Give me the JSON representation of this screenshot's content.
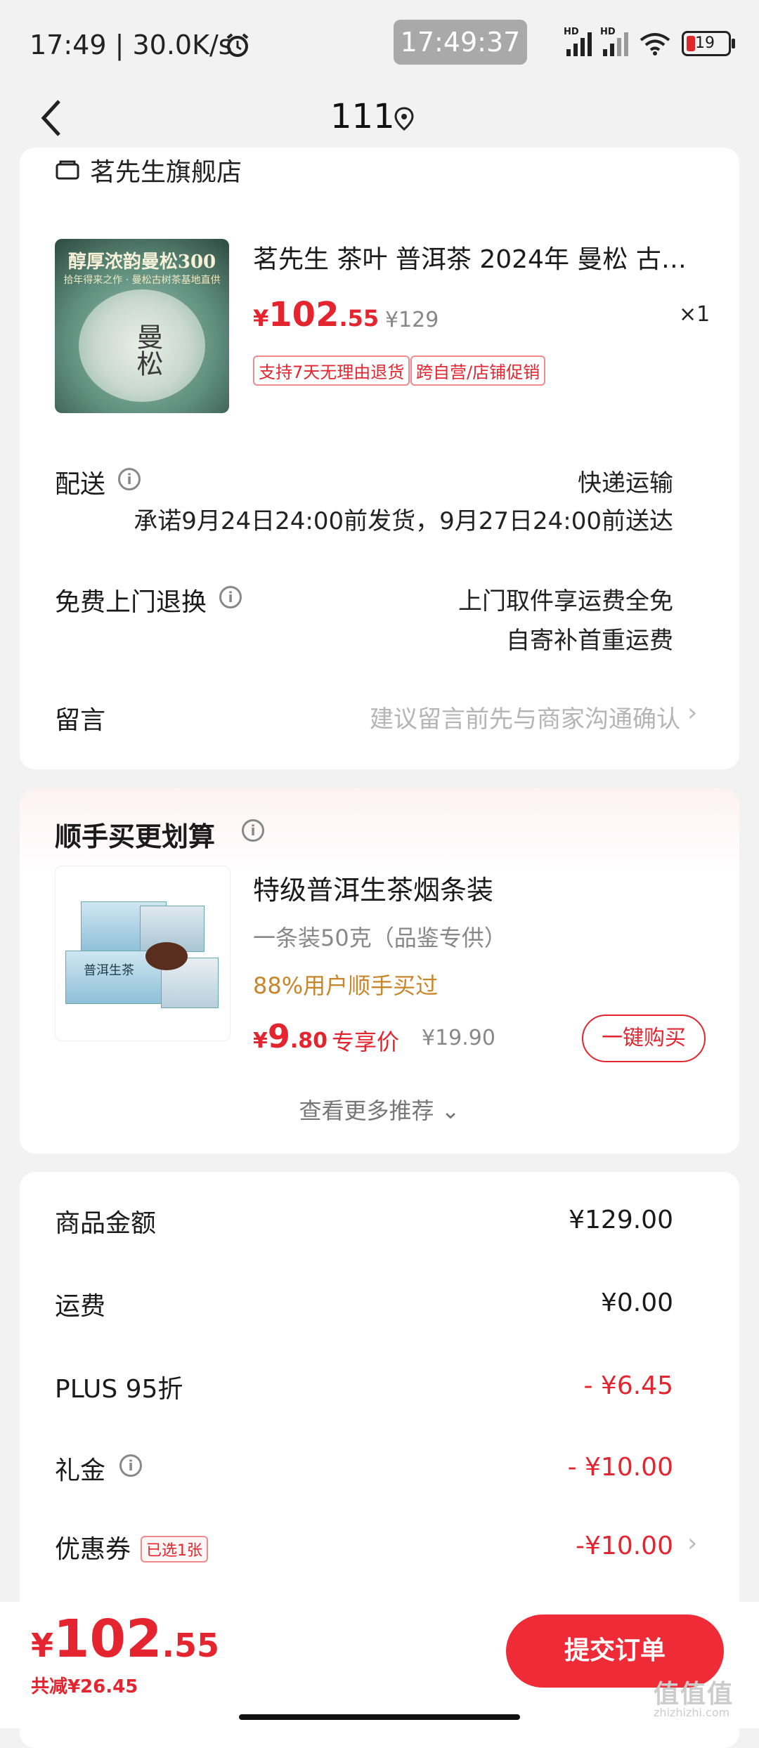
{
  "status_bar": {
    "time_speed": "17:49 | 30.0K/s",
    "clock_overlay": "17:49:37",
    "battery": "19",
    "hd_label": "HD"
  },
  "header": {
    "title": "111"
  },
  "shop": {
    "name": "茗先生旗舰店"
  },
  "product": {
    "image_text_top": "醇厚浓韵曼松300",
    "image_text_sub": "拾年得来之作 · 曼松古树茶基地直供",
    "image_mark": "曼松",
    "title": "茗先生 茶叶 普洱茶 2024年 曼松 古树…",
    "price_currency": "¥",
    "price_int": "102",
    "price_dec": ".55",
    "original_price": "¥129",
    "quantity": "×1",
    "tags": [
      "支持7天无理由退货",
      "跨自营/店铺促销"
    ]
  },
  "delivery": {
    "label": "配送",
    "method": "快递运输",
    "promise": "承诺9月24日24:00前发货，9月27日24:00前送达"
  },
  "return": {
    "label": "免费上门退换",
    "line1": "上门取件享运费全免",
    "line2": "自寄补首重运费"
  },
  "message": {
    "label": "留言",
    "placeholder": "建议留言前先与商家沟通确认"
  },
  "recommend": {
    "title": "顺手买更划算",
    "item_name": "特级普洱生茶烟条装",
    "item_sub": "一条装50克（品鉴专供）",
    "item_hint": "88%用户顺手买过",
    "price_currency": "¥",
    "price_int": "9",
    "price_dec": ".80",
    "exclusive": "专享价",
    "original_price": "¥19.90",
    "buy_label": "一键购买",
    "more_label": "查看更多推荐 ⌄",
    "image_box_text": "普洱生茶"
  },
  "summary": {
    "rows": [
      {
        "label": "商品金额",
        "value": "¥129.00"
      },
      {
        "label": "运费",
        "value": "¥0.00"
      },
      {
        "label": "PLUS 95折",
        "value": "- ¥6.45"
      },
      {
        "label": "礼金",
        "value": "- ¥10.00"
      },
      {
        "label": "优惠券",
        "value": "-¥10.00"
      }
    ],
    "coupon_badge": "已选1张"
  },
  "bottom": {
    "total_currency": "¥",
    "total_int": "102",
    "total_dec": ".55",
    "saved": "共减¥26.45",
    "submit": "提交订单"
  },
  "watermark": {
    "main": "值值值",
    "url": "zhizhizhi.com"
  },
  "colors": {
    "accent": "#e4252f",
    "submit_bg": "#ee2b36",
    "hint": "#c8862a"
  }
}
